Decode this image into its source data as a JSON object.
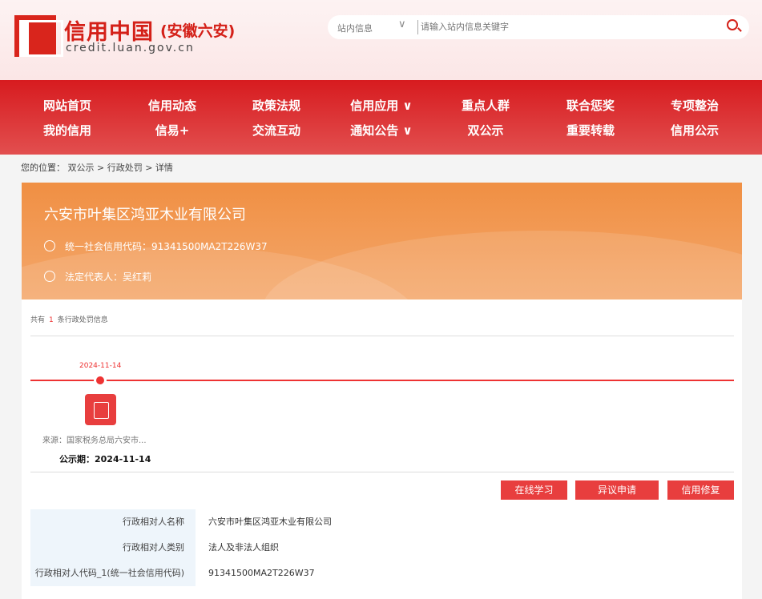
{
  "header": {
    "title": "信用中国",
    "region": "(安徽六安)",
    "url": "credit.luan.gov.cn"
  },
  "search": {
    "scope": "站内信息",
    "placeholder": "请输入站内信息关键字"
  },
  "nav": [
    [
      "网站首页",
      "信用动态",
      "政策法规",
      "信用应用 ∨",
      "重点人群",
      "联合惩奖",
      "专项整治"
    ],
    [
      "我的信用",
      "信易+",
      "交流互动",
      "通知公告 ∨",
      "双公示",
      "重要转载",
      "信用公示"
    ]
  ],
  "breadcrumb": "您的位置： 双公示 > 行政处罚 > 详情",
  "company": {
    "name": "六安市叶集区鸿亚木业有限公司",
    "credit_code": "统一社会信用代码：91341500MA2T226W37",
    "legal_rep": "法定代表人：吴红莉"
  },
  "count": {
    "prefix": "共有",
    "n": "1",
    "suffix": "条行政处罚信息"
  },
  "timeline": {
    "date": "2024-11-14",
    "source": "来源：国家税务总局六安市...",
    "publish": "公示期：2024-11-14"
  },
  "buttons": {
    "learn": "在线学习",
    "objection": "异议申请",
    "repair": "信用修复"
  },
  "details": [
    {
      "k": "行政相对人名称",
      "v": "六安市叶集区鸿亚木业有限公司"
    },
    {
      "k": "行政相对人类别",
      "v": "法人及非法人组织"
    },
    {
      "k": "行政相对人代码_1(统一社会信用代码)",
      "v": "91341500MA2T226W37"
    }
  ]
}
